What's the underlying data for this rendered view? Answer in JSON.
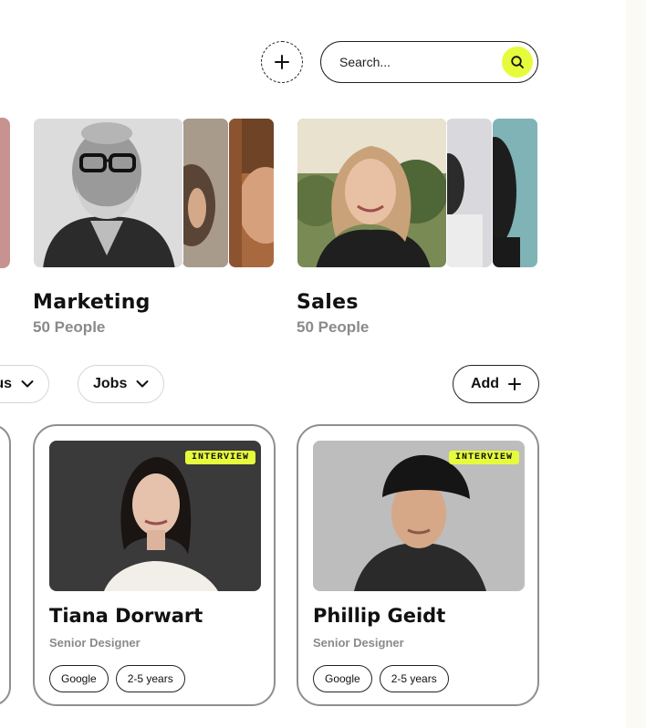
{
  "header": {
    "add_icon": "plus-icon",
    "search": {
      "placeholder": "Search...",
      "value": "",
      "icon": "search-icon",
      "accent": "#e6fb3c"
    }
  },
  "groups": [
    {
      "title": "Marketing",
      "count": "50 People"
    },
    {
      "title": "Sales",
      "count": "50 People"
    }
  ],
  "filters": [
    {
      "label": "tus",
      "icon": "chevron-down-icon"
    },
    {
      "label": "Jobs",
      "icon": "chevron-down-icon"
    }
  ],
  "add_button": {
    "label": "Add",
    "icon": "plus-icon"
  },
  "people": [
    {
      "name": "Tiana Dorwart",
      "role": "Senior Designer",
      "badge": "INTERVIEW",
      "tags": [
        "Google",
        "2-5 years"
      ]
    },
    {
      "name": "Phillip Geidt",
      "role": "Senior Designer",
      "badge": "INTERVIEW",
      "tags": [
        "Google",
        "2-5 years"
      ]
    }
  ],
  "colors": {
    "accent": "#e6fb3c",
    "muted_text": "#8a8a8a",
    "card_border": "#8f8f8f"
  }
}
